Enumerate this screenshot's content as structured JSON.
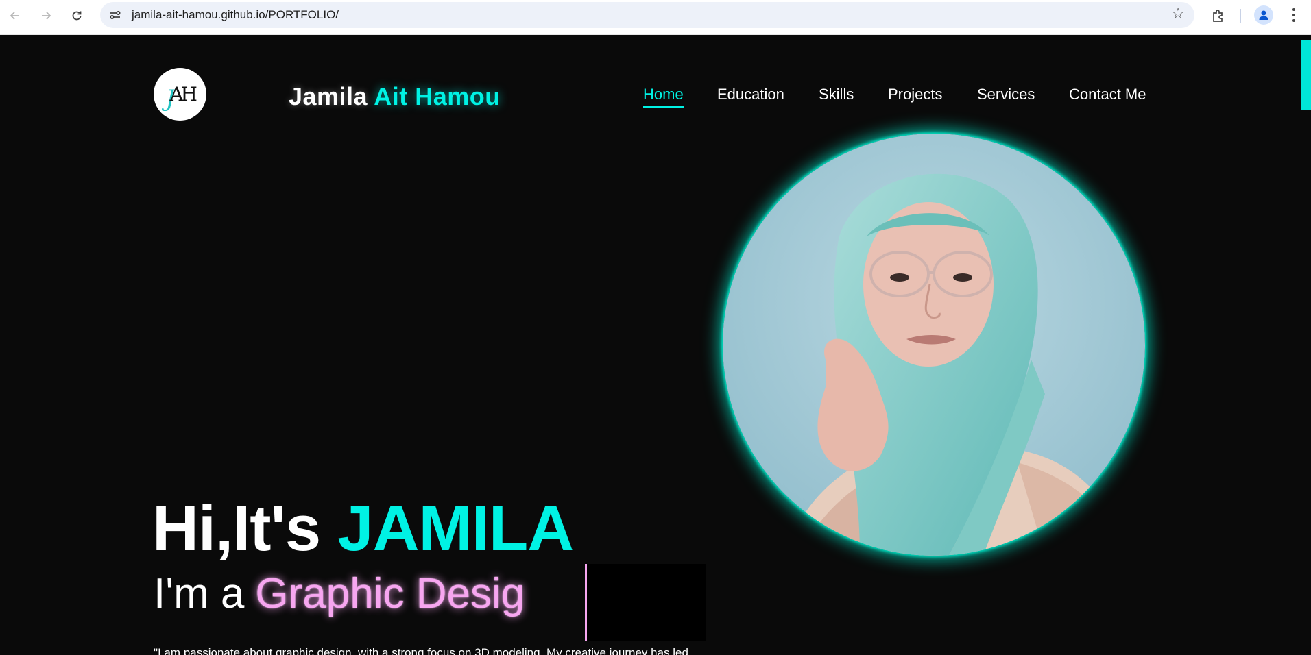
{
  "browser": {
    "url": "jamila-ait-hamou.github.io/PORTFOLIO/",
    "back_icon": "arrow-left-icon",
    "forward_icon": "arrow-right-icon",
    "reload_icon": "reload-icon"
  },
  "header": {
    "logo_letters": {
      "a": "A",
      "j": "J",
      "h": "H"
    },
    "brand_first": "Jamila",
    "brand_accent": "Ait Hamou",
    "nav": [
      "Home",
      "Education",
      "Skills",
      "Projects",
      "Services",
      "Contact Me"
    ],
    "active_nav": "Home"
  },
  "hero": {
    "greeting": "Hi,It's",
    "name": "JAMILA",
    "role_prefix": "I'm a",
    "role_typed": "Graphic Desig",
    "intro": "\"I am passionate about graphic design, with a strong focus on 3D modeling. My creative journey has led"
  },
  "colors": {
    "accent": "#00f2e4",
    "pink": "#f7a6f0",
    "background": "#0a0a0a"
  }
}
